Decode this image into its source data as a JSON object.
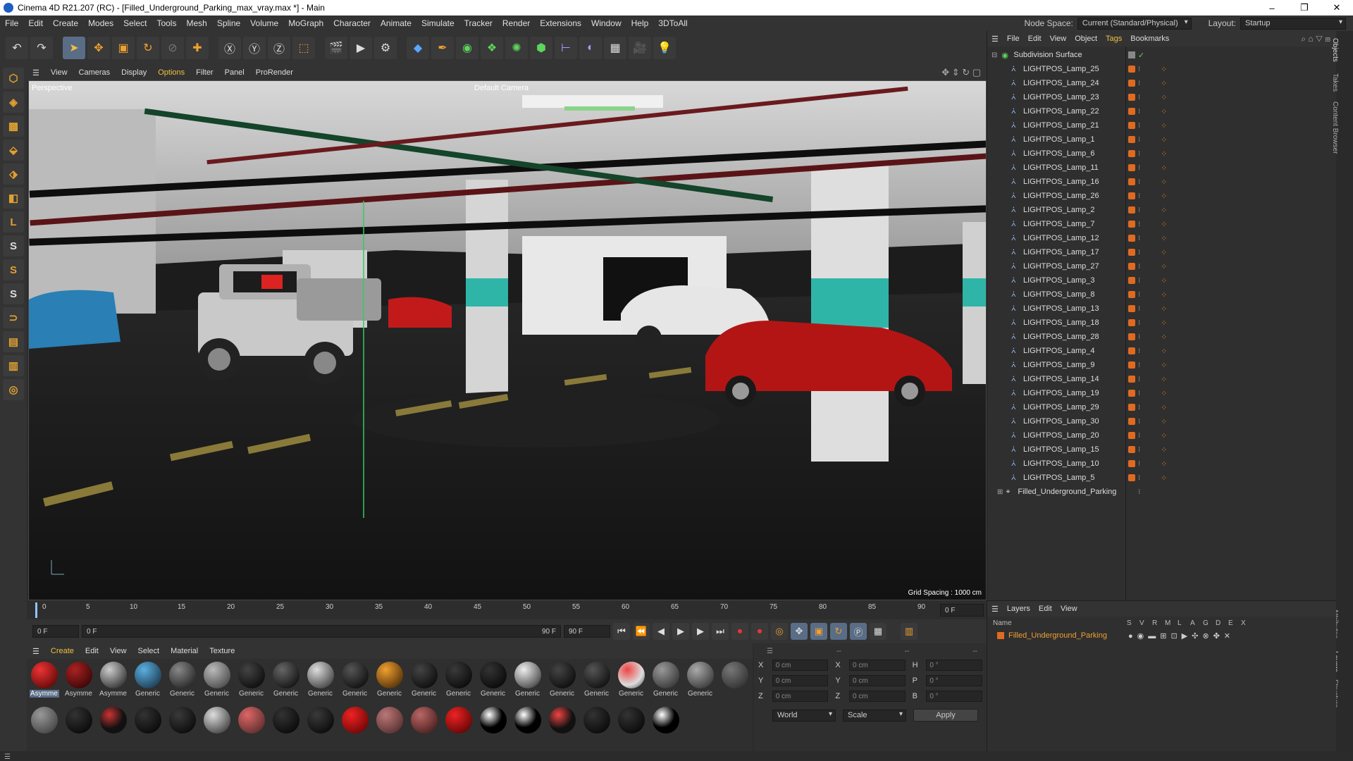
{
  "window": {
    "title": "Cinema 4D R21.207 (RC) - [Filled_Underground_Parking_max_vray.max *] - Main",
    "minimize": "–",
    "maximize": "❐",
    "close": "✕"
  },
  "menu": [
    "File",
    "Edit",
    "Create",
    "Modes",
    "Select",
    "Tools",
    "Mesh",
    "Spline",
    "Volume",
    "MoGraph",
    "Character",
    "Animate",
    "Simulate",
    "Tracker",
    "Render",
    "Extensions",
    "Window",
    "Help",
    "3DToAll"
  ],
  "node_space": {
    "label": "Node Space:",
    "value": "Current (Standard/Physical)"
  },
  "layout": {
    "label": "Layout:",
    "value": "Startup"
  },
  "viewport_menu": [
    "View",
    "Cameras",
    "Display",
    "Options",
    "Filter",
    "Panel",
    "ProRender"
  ],
  "viewport": {
    "name": "Perspective",
    "camera": "Default Camera",
    "grid": "Grid Spacing : 1000 cm"
  },
  "objects_menu": [
    "File",
    "Edit",
    "View",
    "Object",
    "Tags",
    "Bookmarks"
  ],
  "objects": {
    "root": "Subdivision Surface",
    "lamps": [
      "LIGHTPOS_Lamp_25",
      "LIGHTPOS_Lamp_24",
      "LIGHTPOS_Lamp_23",
      "LIGHTPOS_Lamp_22",
      "LIGHTPOS_Lamp_21",
      "LIGHTPOS_Lamp_1",
      "LIGHTPOS_Lamp_6",
      "LIGHTPOS_Lamp_11",
      "LIGHTPOS_Lamp_16",
      "LIGHTPOS_Lamp_26",
      "LIGHTPOS_Lamp_2",
      "LIGHTPOS_Lamp_7",
      "LIGHTPOS_Lamp_12",
      "LIGHTPOS_Lamp_17",
      "LIGHTPOS_Lamp_27",
      "LIGHTPOS_Lamp_3",
      "LIGHTPOS_Lamp_8",
      "LIGHTPOS_Lamp_13",
      "LIGHTPOS_Lamp_18",
      "LIGHTPOS_Lamp_28",
      "LIGHTPOS_Lamp_4",
      "LIGHTPOS_Lamp_9",
      "LIGHTPOS_Lamp_14",
      "LIGHTPOS_Lamp_19",
      "LIGHTPOS_Lamp_29",
      "LIGHTPOS_Lamp_30",
      "LIGHTPOS_Lamp_20",
      "LIGHTPOS_Lamp_15",
      "LIGHTPOS_Lamp_10",
      "LIGHTPOS_Lamp_5"
    ],
    "group": "Filled_Underground_Parking"
  },
  "side_tabs": [
    "Objects",
    "Takes",
    "Content Browser",
    "Attributes",
    "Layers",
    "Structure"
  ],
  "timeline": {
    "ticks": [
      "0",
      "5",
      "10",
      "15",
      "20",
      "25",
      "30",
      "35",
      "40",
      "45",
      "50",
      "55",
      "60",
      "65",
      "70",
      "75",
      "80",
      "85",
      "90"
    ],
    "current": "0 F"
  },
  "playback": {
    "start": "0 F",
    "range_start": "0 F",
    "range_end": "90 F",
    "end": "90 F"
  },
  "materials_menu": [
    "Create",
    "Edit",
    "View",
    "Select",
    "Material",
    "Texture"
  ],
  "materials_row1": [
    "Asymme",
    "Asymme",
    "Asymme",
    "Generic",
    "Generic",
    "Generic",
    "Generic",
    "Generic",
    "Generic",
    "Generic",
    "Generic",
    "Generic",
    "Generic",
    "Generic",
    "Generic",
    "Generic",
    "Generic",
    "Generic",
    "Generic",
    "Generic"
  ],
  "coords": {
    "header": [
      "--",
      "--",
      "--"
    ],
    "rows": [
      {
        "a": "X",
        "av": "0 cm",
        "b": "X",
        "bv": "0 cm",
        "c": "H",
        "cv": "0 °"
      },
      {
        "a": "Y",
        "av": "0 cm",
        "b": "Y",
        "bv": "0 cm",
        "c": "P",
        "cv": "0 °"
      },
      {
        "a": "Z",
        "av": "0 cm",
        "b": "Z",
        "bv": "0 cm",
        "c": "B",
        "cv": "0 °"
      }
    ],
    "world": "World",
    "scale": "Scale",
    "apply": "Apply"
  },
  "layers_menu": [
    "Layers",
    "Edit",
    "View"
  ],
  "layers": {
    "header_name": "Name",
    "cols": [
      "S",
      "V",
      "R",
      "M",
      "L",
      "A",
      "G",
      "D",
      "E",
      "X"
    ],
    "item": "Filled_Underground_Parking"
  }
}
